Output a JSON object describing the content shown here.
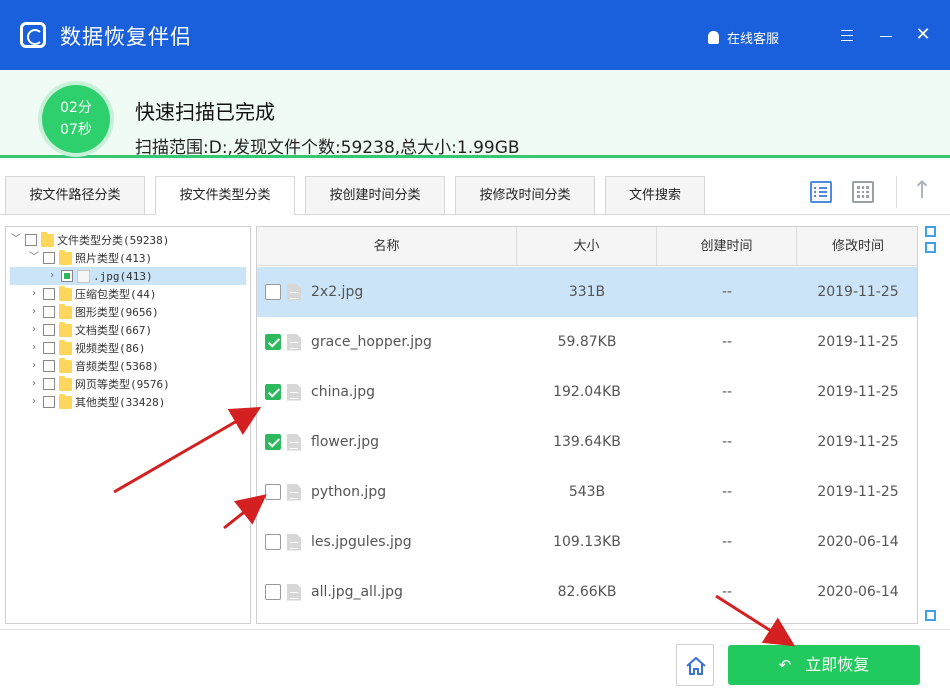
{
  "app": {
    "title": "数据恢复伴侣",
    "support_label": "在线客服"
  },
  "scan": {
    "timer_minutes": "02分",
    "timer_seconds": "07秒",
    "status": "快速扫描已完成",
    "detail": "扫描范围:D:,发现文件个数:59238,总大小:1.99GB"
  },
  "tabs": [
    {
      "label": "按文件路径分类",
      "active": false
    },
    {
      "label": "按文件类型分类",
      "active": true
    },
    {
      "label": "按创建时间分类",
      "active": false
    },
    {
      "label": "按修改时间分类",
      "active": false
    },
    {
      "label": "文件搜索",
      "active": false
    }
  ],
  "tree": [
    {
      "label": "文件类型分类(59238)",
      "level": 0,
      "expanded": true,
      "checked": "none"
    },
    {
      "label": "照片类型(413)",
      "level": 1,
      "expanded": true,
      "checked": "none"
    },
    {
      "label": ".jpg(413)",
      "level": 2,
      "expanded": false,
      "checked": "partial",
      "selected": true
    },
    {
      "label": "压缩包类型(44)",
      "level": 1,
      "expanded": false,
      "checked": "none"
    },
    {
      "label": "图形类型(9656)",
      "level": 1,
      "expanded": false,
      "checked": "none"
    },
    {
      "label": "文档类型(667)",
      "level": 1,
      "expanded": false,
      "checked": "none"
    },
    {
      "label": "视频类型(86)",
      "level": 1,
      "expanded": false,
      "checked": "none"
    },
    {
      "label": "音频类型(5368)",
      "level": 1,
      "expanded": false,
      "checked": "none"
    },
    {
      "label": "网页等类型(9576)",
      "level": 1,
      "expanded": false,
      "checked": "none"
    },
    {
      "label": "其他类型(33428)",
      "level": 1,
      "expanded": false,
      "checked": "none"
    }
  ],
  "table": {
    "columns": [
      "名称",
      "大小",
      "创建时间",
      "修改时间"
    ],
    "rows": [
      {
        "name": "2x2.jpg",
        "size": "331B",
        "created": "--",
        "modified": "2019-11-25",
        "checked": false,
        "selected": true
      },
      {
        "name": "grace_hopper.jpg",
        "size": "59.87KB",
        "created": "--",
        "modified": "2019-11-25",
        "checked": true,
        "selected": false
      },
      {
        "name": "china.jpg",
        "size": "192.04KB",
        "created": "--",
        "modified": "2019-11-25",
        "checked": true,
        "selected": false
      },
      {
        "name": "flower.jpg",
        "size": "139.64KB",
        "created": "--",
        "modified": "2019-11-25",
        "checked": true,
        "selected": false
      },
      {
        "name": "python.jpg",
        "size": "543B",
        "created": "--",
        "modified": "2019-11-25",
        "checked": false,
        "selected": false
      },
      {
        "name": "les.jpgules.jpg",
        "size": "109.13KB",
        "created": "--",
        "modified": "2020-06-14",
        "checked": false,
        "selected": false
      },
      {
        "name": "all.jpg_all.jpg",
        "size": "82.66KB",
        "created": "--",
        "modified": "2020-06-14",
        "checked": false,
        "selected": false
      }
    ]
  },
  "footer": {
    "recover_label": "立即恢复"
  },
  "colors": {
    "titlebar": "#1a5fdc",
    "accent_green": "#22c95f",
    "selection": "#cce4f7",
    "annotation_arrow": "#d42020"
  },
  "icons": {
    "logo": "app-logo-icon",
    "support": "bell-icon",
    "menu": "menu-icon",
    "minimize": "minimize-icon",
    "close": "close-icon",
    "list_view": "list-view-icon",
    "grid_view": "grid-view-icon",
    "up": "arrow-up-icon",
    "home": "home-icon",
    "recover": "undo-icon"
  }
}
